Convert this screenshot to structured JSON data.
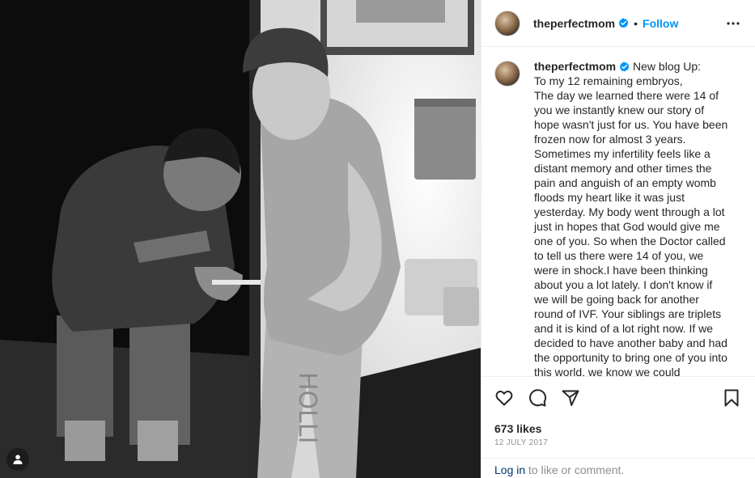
{
  "post": {
    "username": "theperfectmom",
    "follow_label": "Follow",
    "separator": "•",
    "caption": "New blog Up:\nTo my 12 remaining embryos,\nThe day we learned there were 14 of you we instantly knew our story of hope wasn't just for us. You have been frozen now for almost 3 years. Sometimes my infertility feels like a distant memory and other times the pain and anguish of an empty womb floods my heart like it was just yesterday. My body went through a lot just in hopes that God would give me one of you. So when the Doctor called to tell us there were 14 of you, we were in shock.I have been thinking about you a lot lately. I don't know if we will be going back for another round of IVF. Your siblings are triplets and it is kind of a lot right now. If we decided to have another baby and had the opportunity to bring one of you into this world, we know we could",
    "likes": "673 likes",
    "date": "12 JULY 2017"
  },
  "footer": {
    "login_label": "Log in",
    "comment_suffix": " to like or comment."
  },
  "icons": {
    "verified": "verified-badge-icon",
    "more": "more-options-icon",
    "like": "heart-icon",
    "comment": "comment-icon",
    "share": "share-icon",
    "save": "bookmark-icon",
    "user_tag": "user-tag-icon"
  },
  "colors": {
    "accent": "#0095f6",
    "verified": "#0095f6",
    "link": "#00376b",
    "muted": "#8e8e8e",
    "border": "#efefef"
  }
}
